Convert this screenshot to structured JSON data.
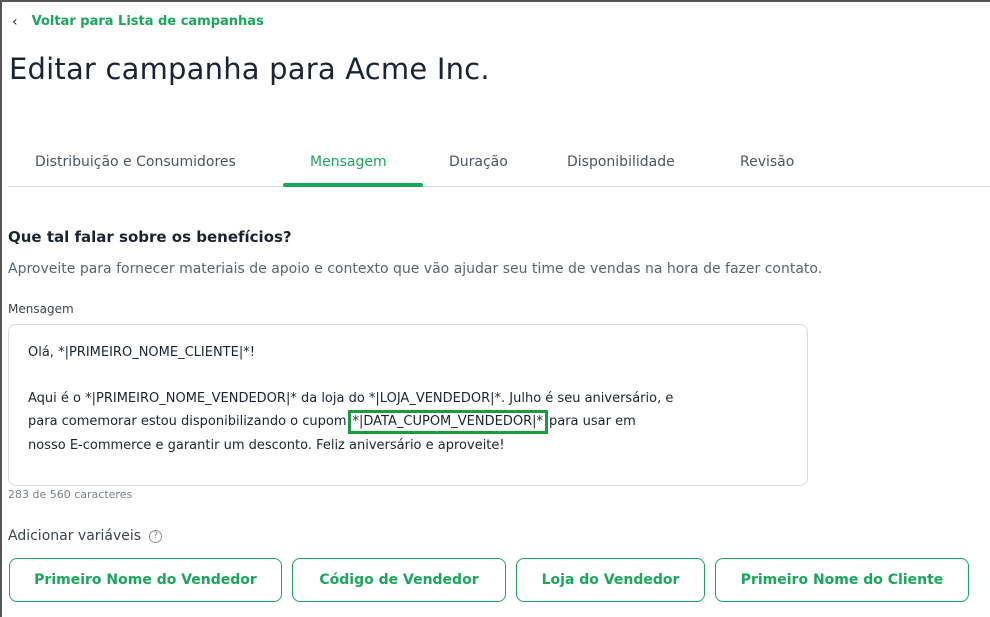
{
  "back_link": {
    "icon": "chevron-left-icon",
    "label": "Voltar para Lista de campanhas"
  },
  "page_title": "Editar campanha para Acme Inc.",
  "tabs": [
    {
      "label": "Distribuição e Consumidores",
      "active": false
    },
    {
      "label": "Mensagem",
      "active": true
    },
    {
      "label": "Duração",
      "active": false
    },
    {
      "label": "Disponibilidade",
      "active": false
    },
    {
      "label": "Revisão",
      "active": false
    }
  ],
  "section": {
    "title": "Que tal falar sobre os benefícios?",
    "description": "Aproveite para fornecer materiais de apoio e contexto que vão ajudar seu time de vendas na hora de fazer contato."
  },
  "message": {
    "label": "Mensagem",
    "line1": "Olá,  *|PRIMEIRO_NOME_CLIENTE|*!",
    "line2": "Aqui é o  *|PRIMEIRO_NOME_VENDEDOR|* da loja do  *|LOJA_VENDEDOR|*. Julho é seu aniversário, e",
    "line3_before": "para comemorar estou disponibilizando o cupom",
    "line3_highlight": "*|DATA_CUPOM_VENDEDOR|*",
    "line3_after": "para usar em",
    "line4": "nosso E-commerce e garantir um desconto. Feliz aniversário e aproveite!",
    "counter": "283 de 560 caracteres"
  },
  "variables": {
    "label": "Adicionar variáveis",
    "help_icon": "question-circle-icon",
    "buttons": [
      "Primeiro Nome do Vendedor",
      "Código de Vendedor",
      "Loja do Vendedor",
      "Primeiro Nome do Cliente"
    ]
  },
  "colors": {
    "accent": "#17a85a",
    "highlight_border": "#1a9c3c",
    "text": "#1c2434"
  }
}
